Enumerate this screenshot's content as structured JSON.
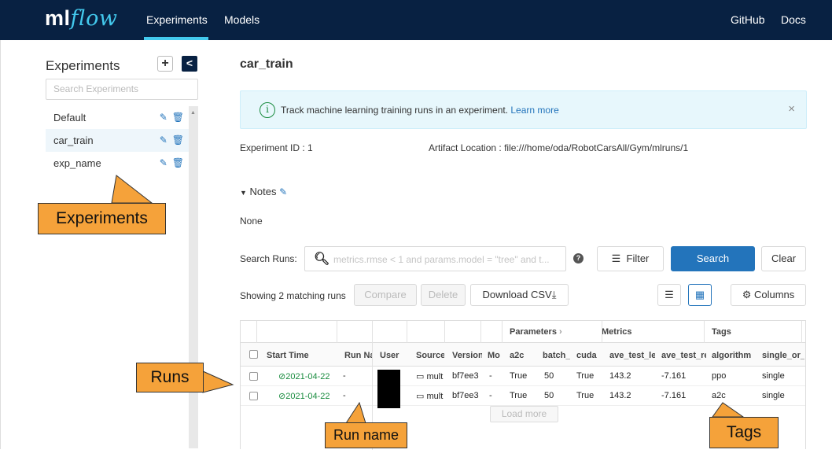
{
  "nav": {
    "logo_ml": "ml",
    "logo_flow": "flow",
    "experiments": "Experiments",
    "models": "Models",
    "github": "GitHub",
    "docs": "Docs"
  },
  "sidebar": {
    "title": "Experiments",
    "add": "+",
    "collapse": "<",
    "search_placeholder": "Search Experiments",
    "items": [
      {
        "label": "Default"
      },
      {
        "label": "car_train"
      },
      {
        "label": "exp_name"
      }
    ],
    "edit_icon": "✎",
    "delete_icon": "🗑"
  },
  "main": {
    "title": "car_train",
    "info": {
      "text": "Track machine learning training runs in an experiment.",
      "link": "Learn more",
      "close": "×"
    },
    "experiment_id_label": "Experiment ID :",
    "experiment_id": "1",
    "artifact_label": "Artifact Location :",
    "artifact_value": "file:///home/oda/RobotCarsAll/Gym/mlruns/1",
    "notes_label": "Notes",
    "notes_value": "None",
    "search_label": "Search Runs:",
    "search_placeholder": "metrics.rmse < 1 and params.model = \"tree\" and t...",
    "filter": "Filter",
    "search": "Search",
    "clear": "Clear",
    "showing": "Showing 2 matching runs",
    "compare": "Compare",
    "delete": "Delete",
    "download_csv": "Download CSV",
    "columns": "Columns",
    "load_more": "Load more"
  },
  "table": {
    "groups": {
      "parameters": "Parameters",
      "metrics": "Metrics",
      "tags": "Tags"
    },
    "headers": {
      "start_time": "Start Time",
      "run_name": "Run Na",
      "user": "User",
      "source": "Source",
      "version": "Version",
      "model": "Mo",
      "a2c": "a2c",
      "batch": "batch_",
      "cuda": "cuda",
      "ave_test_len": "ave_test_le",
      "ave_test_rew": "ave_test_re",
      "algorithm": "algorithm",
      "single": "single_or_r"
    },
    "rows": [
      {
        "start_time": "2021-04-22 ",
        "run_name": "-",
        "source": "mult",
        "version": "bf7ee3",
        "model": "-",
        "a2c": "True",
        "batch": "50",
        "cuda": "True",
        "ave_test_len": "143.2",
        "ave_test_rew": "-7.161",
        "algorithm": "ppo",
        "single": "single"
      },
      {
        "start_time": "2021-04-22 ",
        "run_name": "-",
        "source": "mult",
        "version": "bf7ee3",
        "model": "-",
        "a2c": "True",
        "batch": "50",
        "cuda": "True",
        "ave_test_len": "143.2",
        "ave_test_rew": "-7.161",
        "algorithm": "a2c",
        "single": "single"
      }
    ]
  },
  "annotations": {
    "experiments": "Experiments",
    "runs": "Runs",
    "run_name": "Run name",
    "tags": "Tags"
  },
  "colors": {
    "nav_bg": "#082142",
    "accent": "#43c9ed",
    "primary": "#2374bb",
    "success": "#1a8c3f",
    "annotation": "#f5a23a"
  }
}
